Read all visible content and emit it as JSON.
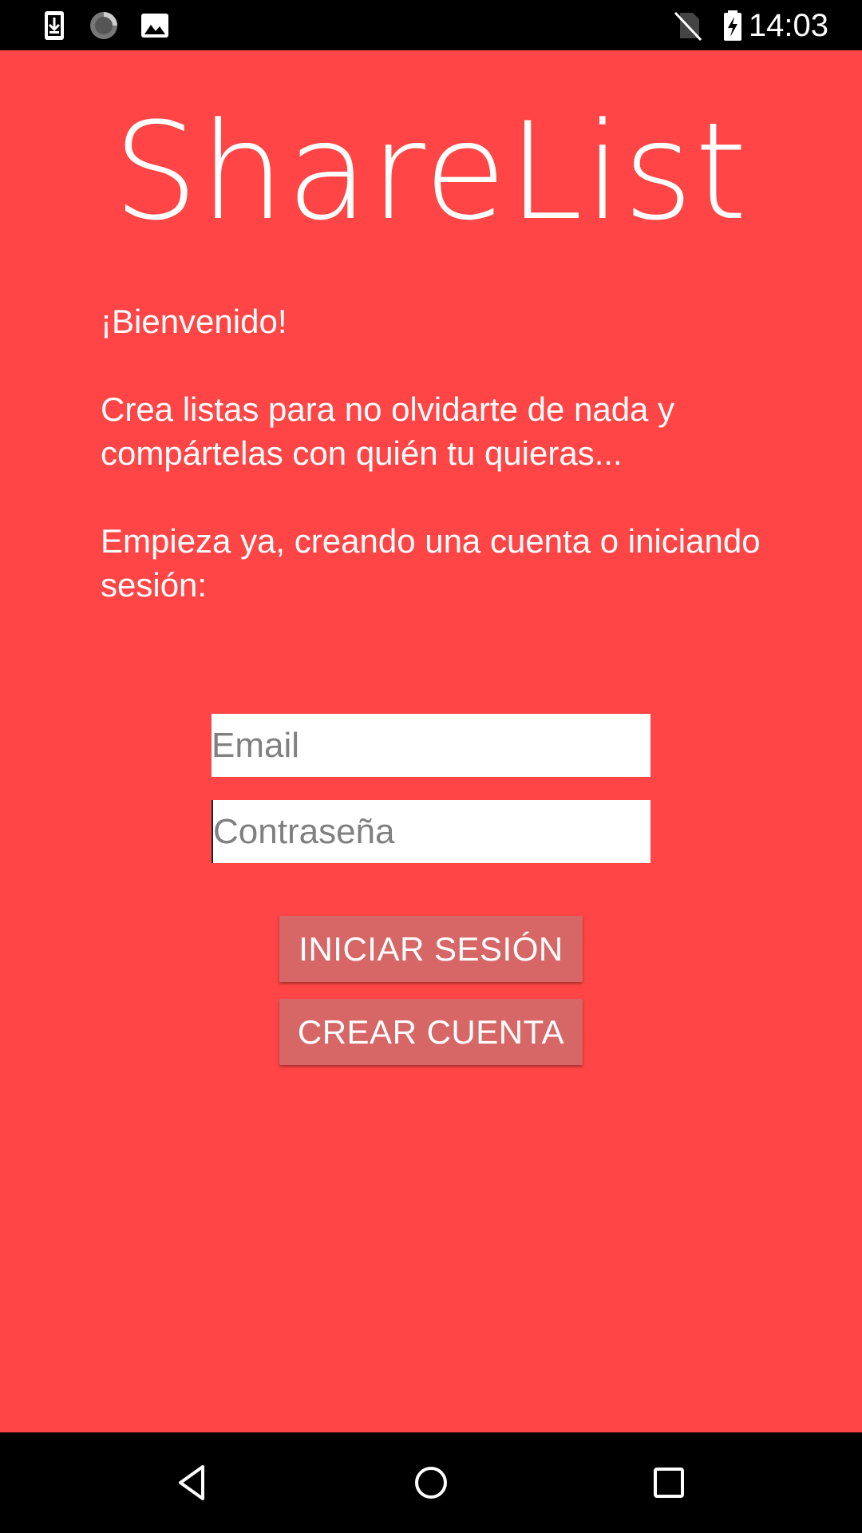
{
  "status_bar": {
    "time": "14:03",
    "left_icons": [
      "download-icon",
      "loading-spinner-icon",
      "image-icon"
    ],
    "right_icons": [
      "no-sim-icon",
      "battery-charging-icon"
    ]
  },
  "app": {
    "logo": "ShareList",
    "background_color": "#ff4545",
    "intro": {
      "welcome": "¡Bienvenido!",
      "description": "Crea listas para no olvidarte de nada y compártelas con quién tu quieras...",
      "call_to_action": "Empieza ya, creando una cuenta o iniciando sesión:"
    },
    "form": {
      "email_placeholder": "Email",
      "password_placeholder": "Contraseña"
    },
    "buttons": {
      "login_label": "INICIAR SESIÓN",
      "create_account_label": "CREAR CUENTA",
      "color": "#d76767"
    }
  },
  "nav_bar": {
    "icons": [
      "back-icon",
      "home-icon",
      "recents-icon"
    ]
  }
}
